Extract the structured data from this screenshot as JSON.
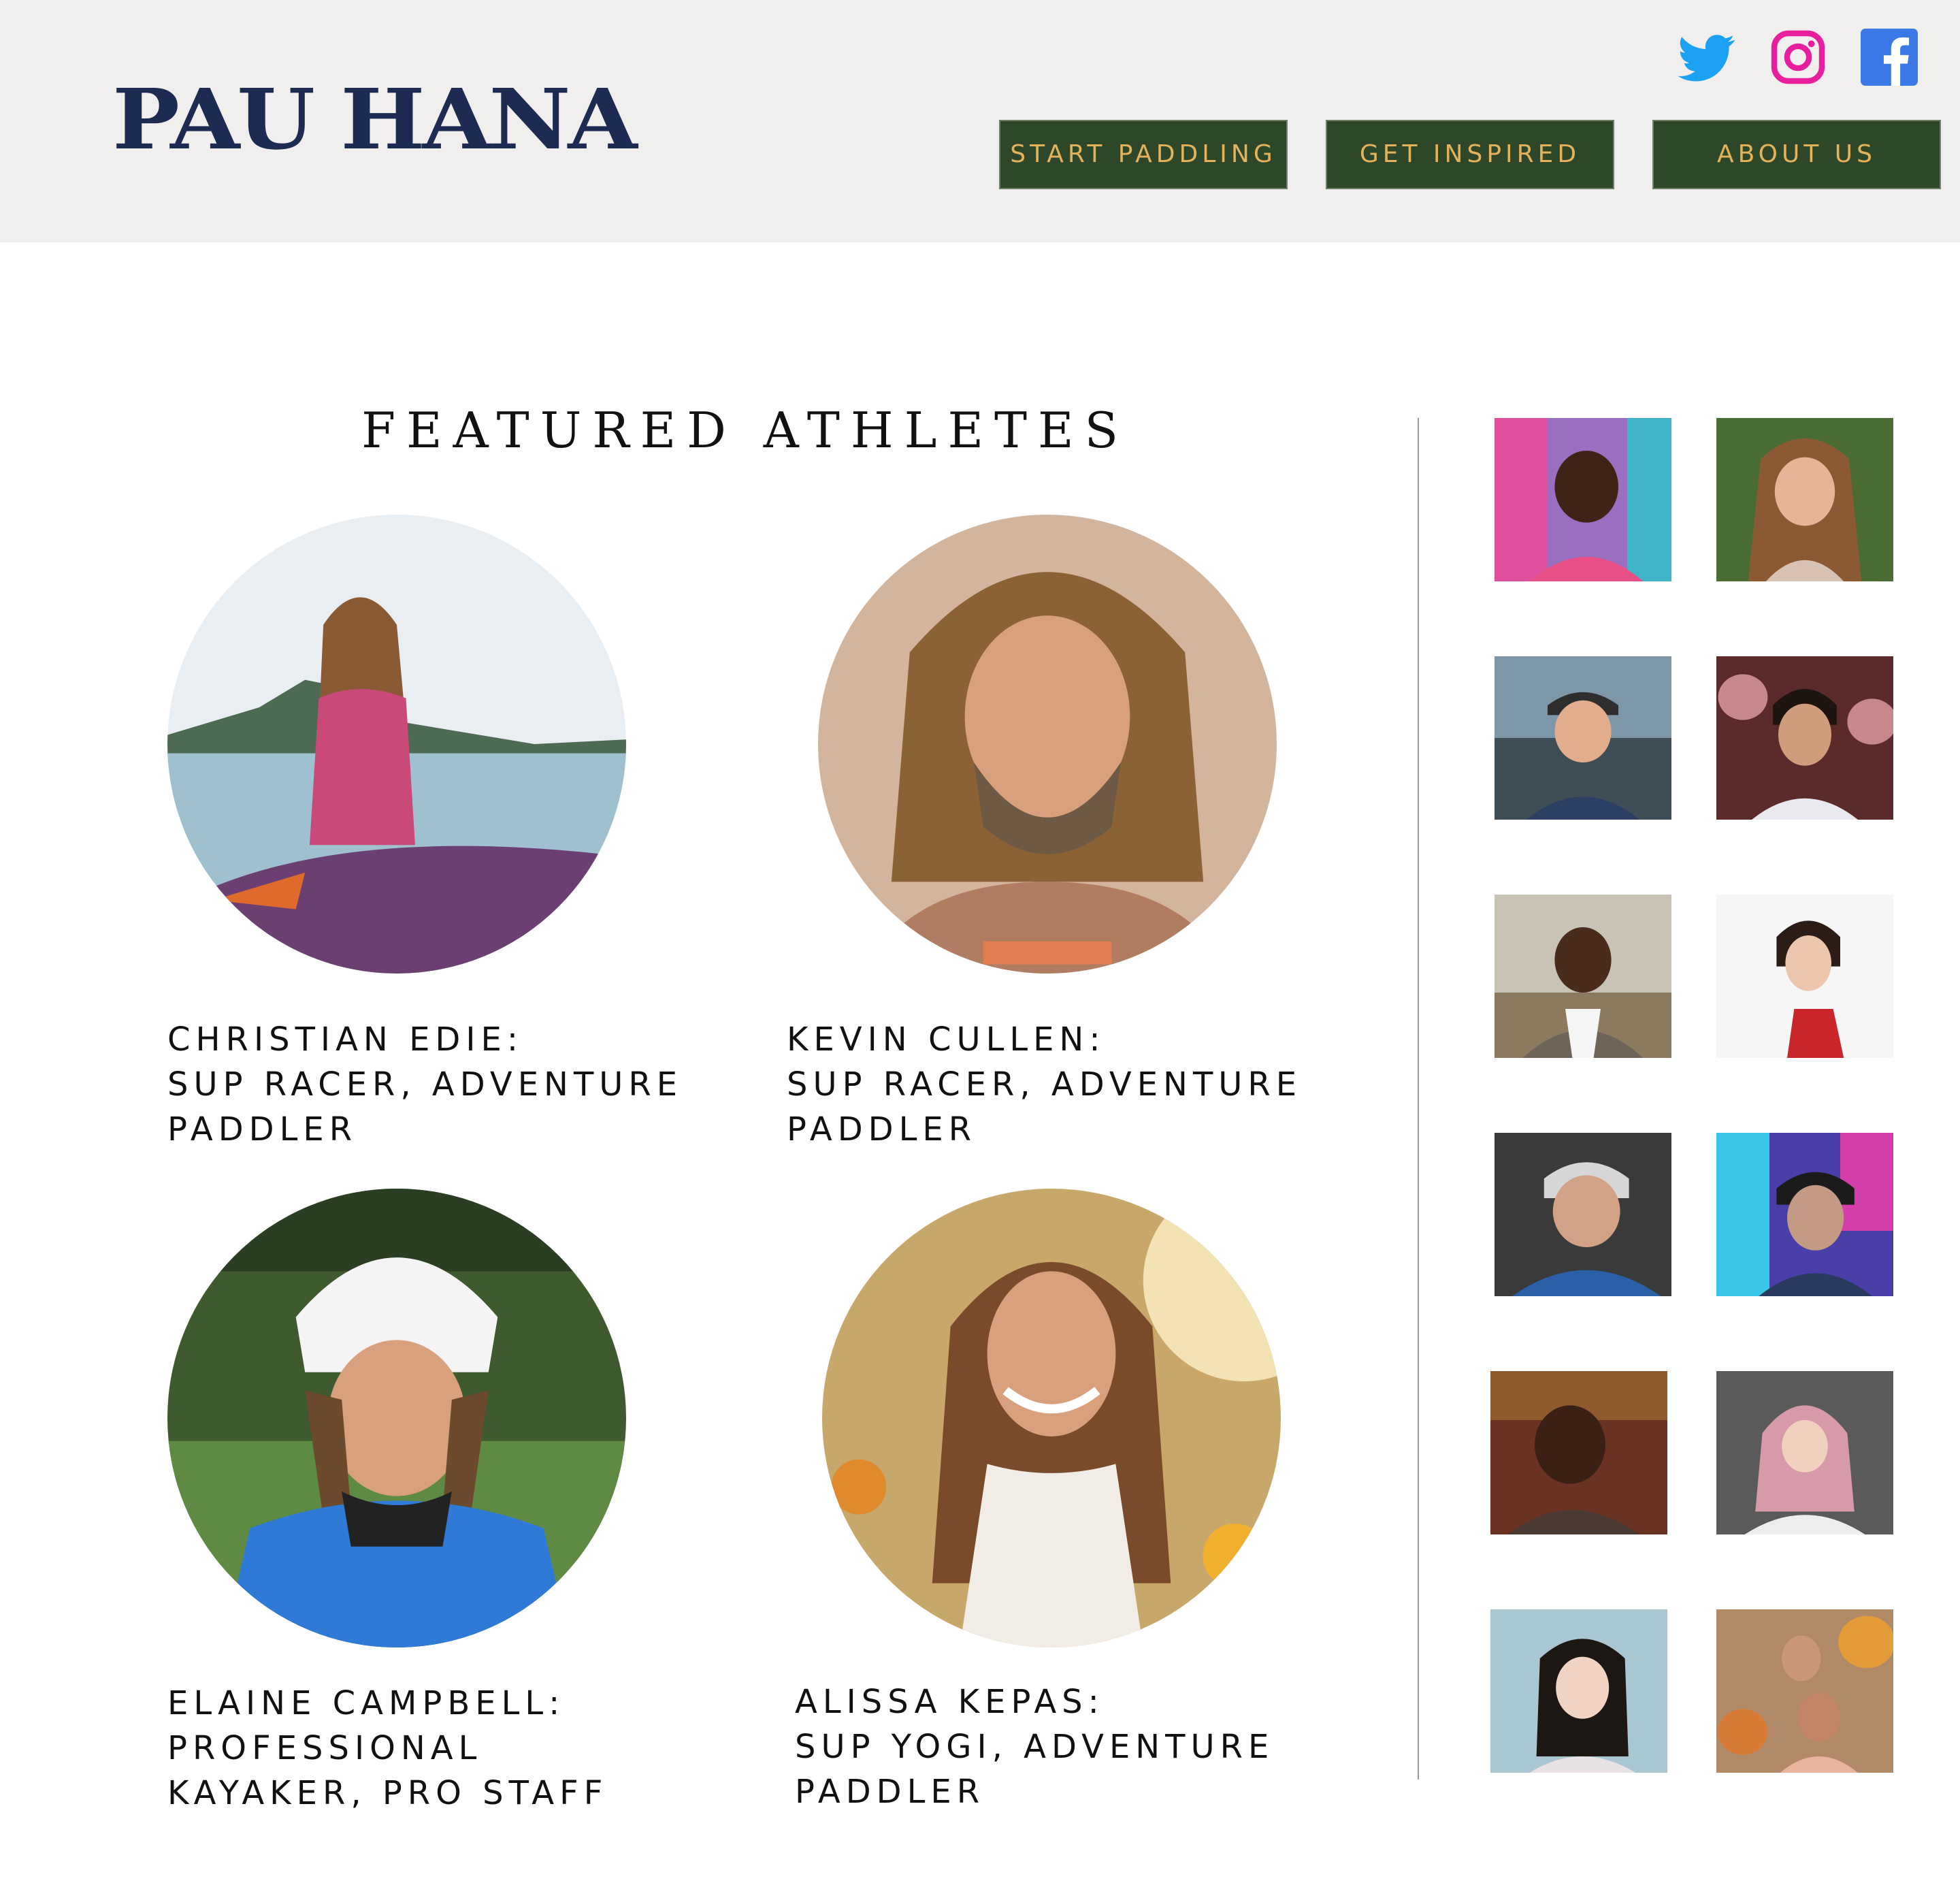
{
  "header": {
    "logo_text": "PAU HANA",
    "social": [
      {
        "icon": "twitter-icon",
        "color": "#1da1f2"
      },
      {
        "icon": "instagram-icon",
        "color": "#e81f9c"
      },
      {
        "icon": "facebook-icon",
        "color": "#3b78e7"
      }
    ],
    "nav": [
      {
        "label": "START PADDLING"
      },
      {
        "label": "GET INSPIRED"
      },
      {
        "label": "ABOUT US"
      }
    ],
    "colors": {
      "background": "#f0efee",
      "button_bg": "#2f4729",
      "button_text": "#e4b25b",
      "logo": "#1d2b52"
    }
  },
  "main": {
    "title": "FEATURED ATHLETES",
    "athletes": [
      {
        "lines": [
          "CHRISTIAN EDIE:",
          "SUP RACER, ADVENTURE",
          "PADDLER"
        ],
        "photo": "athlete-photo-christian-edie"
      },
      {
        "lines": [
          "KEVIN CULLEN:",
          "SUP RACER, ADVENTURE",
          "PADDLER"
        ],
        "photo": "athlete-photo-kevin-cullen"
      },
      {
        "lines": [
          "ELAINE CAMPBELL:",
          "PROFESSIONAL",
          "KAYAKER, PRO STAFF"
        ],
        "photo": "athlete-photo-elaine-campbell"
      },
      {
        "lines": [
          "ALISSA KEPAS:",
          "SUP YOGI, ADVENTURE",
          "PADDLER"
        ],
        "photo": "athlete-photo-alissa-kepas"
      }
    ]
  },
  "sidebar": {
    "thumbnails": [
      {
        "name": "thumb-photo-1"
      },
      {
        "name": "thumb-photo-2"
      },
      {
        "name": "thumb-photo-3"
      },
      {
        "name": "thumb-photo-4"
      },
      {
        "name": "thumb-photo-5"
      },
      {
        "name": "thumb-photo-6"
      },
      {
        "name": "thumb-photo-7"
      },
      {
        "name": "thumb-photo-8"
      },
      {
        "name": "thumb-photo-9"
      },
      {
        "name": "thumb-photo-10"
      },
      {
        "name": "thumb-photo-11"
      },
      {
        "name": "thumb-photo-12"
      }
    ]
  }
}
